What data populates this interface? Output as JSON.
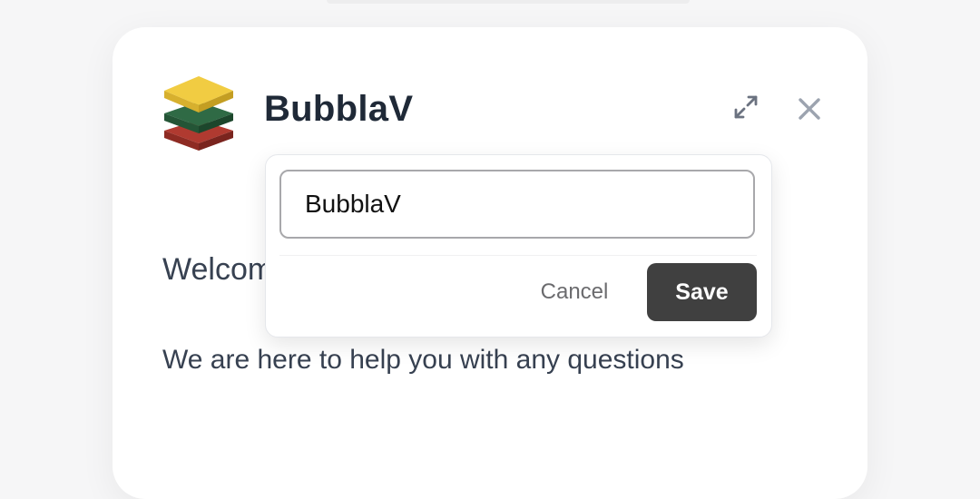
{
  "header": {
    "title": "BubblaV",
    "logo_icon": "layered-stack-logo-icon",
    "expand_icon": "expand-arrows-icon",
    "close_icon": "close-icon"
  },
  "body": {
    "welcome_text": "Welcome",
    "help_text": "We are here to help you with any questions"
  },
  "rename_popover": {
    "input_value": "BubblaV",
    "cancel_label": "Cancel",
    "save_label": "Save"
  },
  "colors": {
    "logo_yellow": "#f1cc42",
    "logo_green": "#2f6a45",
    "logo_red": "#b03a30",
    "save_button_bg": "#404040",
    "title_text": "#1f2937"
  }
}
